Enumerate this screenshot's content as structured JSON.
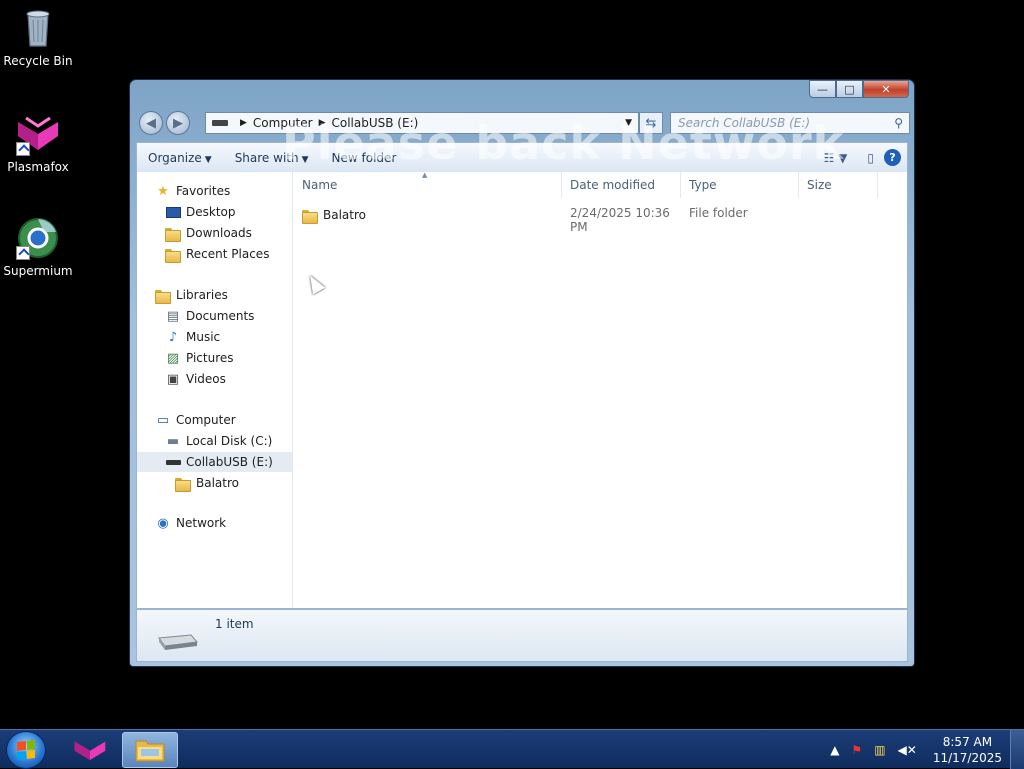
{
  "desktop": {
    "icons": [
      {
        "label": "Recycle Bin",
        "icon": "recycle-bin-icon"
      },
      {
        "label": "Plasmafox",
        "icon": "plasmafox-icon"
      },
      {
        "label": "Supermium",
        "icon": "supermium-icon"
      }
    ],
    "watermark": "Please back Network"
  },
  "window": {
    "caption": {
      "minimize": "—",
      "maximize": "□",
      "close": "✕"
    },
    "address": {
      "segments": [
        "Computer",
        "CollabUSB (E:)"
      ]
    },
    "search": {
      "placeholder": "Search CollabUSB (E:)"
    },
    "toolbar": {
      "organize": "Organize",
      "share_with": "Share with",
      "new_folder": "New folder"
    },
    "nav": {
      "favorites": "Favorites",
      "desktop": "Desktop",
      "downloads": "Downloads",
      "recent_places": "Recent Places",
      "libraries": "Libraries",
      "documents": "Documents",
      "music": "Music",
      "pictures": "Pictures",
      "videos": "Videos",
      "computer": "Computer",
      "local_disk": "Local Disk (C:)",
      "collabusb": "CollabUSB (E:)",
      "balatro": "Balatro",
      "network": "Network"
    },
    "columns": {
      "name": "Name",
      "date_modified": "Date modified",
      "type": "Type",
      "size": "Size"
    },
    "files": [
      {
        "name": "Balatro",
        "date_modified": "2/24/2025 10:36 PM",
        "type": "File folder",
        "size": ""
      }
    ],
    "details": {
      "item_count": "1 item"
    }
  },
  "taskbar": {
    "clock": {
      "time": "8:57 AM",
      "date": "11/17/2025"
    }
  },
  "colors": {
    "accent": "#1f5fb8",
    "taskbar": "#1c3d78",
    "folder": "#f8dd84",
    "plasmafox": "#e83ab8"
  }
}
